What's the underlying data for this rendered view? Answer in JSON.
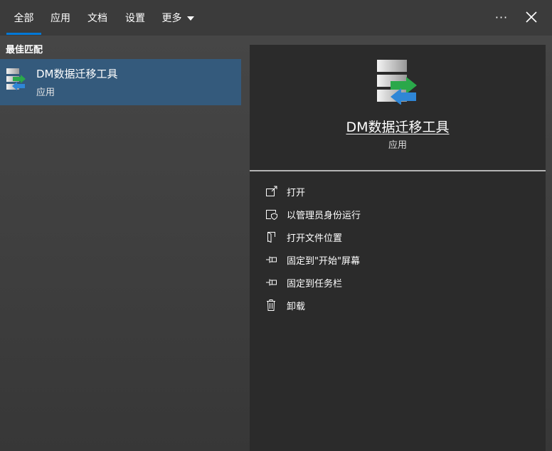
{
  "tabs": [
    {
      "label": "全部",
      "active": true
    },
    {
      "label": "应用"
    },
    {
      "label": "文档"
    },
    {
      "label": "设置"
    },
    {
      "label": "更多"
    }
  ],
  "header": {
    "more_icon": "more-dots-icon",
    "more_glyph": "···",
    "close_icon": "close-icon"
  },
  "left": {
    "section_title": "最佳匹配",
    "best_match": {
      "title": "DM数据迁移工具",
      "subtitle": "应用",
      "icon": "dm-migration-tool-icon"
    }
  },
  "detail": {
    "title": "DM数据迁移工具",
    "subtitle": "应用",
    "icon": "dm-migration-tool-icon",
    "actions": [
      {
        "label": "打开",
        "icon": "open-icon"
      },
      {
        "label": "以管理员身份运行",
        "icon": "run-as-admin-icon"
      },
      {
        "label": "打开文件位置",
        "icon": "file-location-icon"
      },
      {
        "label": "固定到\"开始\"屏幕",
        "icon": "pin-icon"
      },
      {
        "label": "固定到任务栏",
        "icon": "pin-icon"
      },
      {
        "label": "卸载",
        "icon": "trash-icon"
      }
    ]
  },
  "colors": {
    "accent": "#0078d7",
    "selection": "#345a7c",
    "panel": "#2b2b2b",
    "arrow_green": "#2aa84a",
    "arrow_blue": "#2f86d6"
  }
}
